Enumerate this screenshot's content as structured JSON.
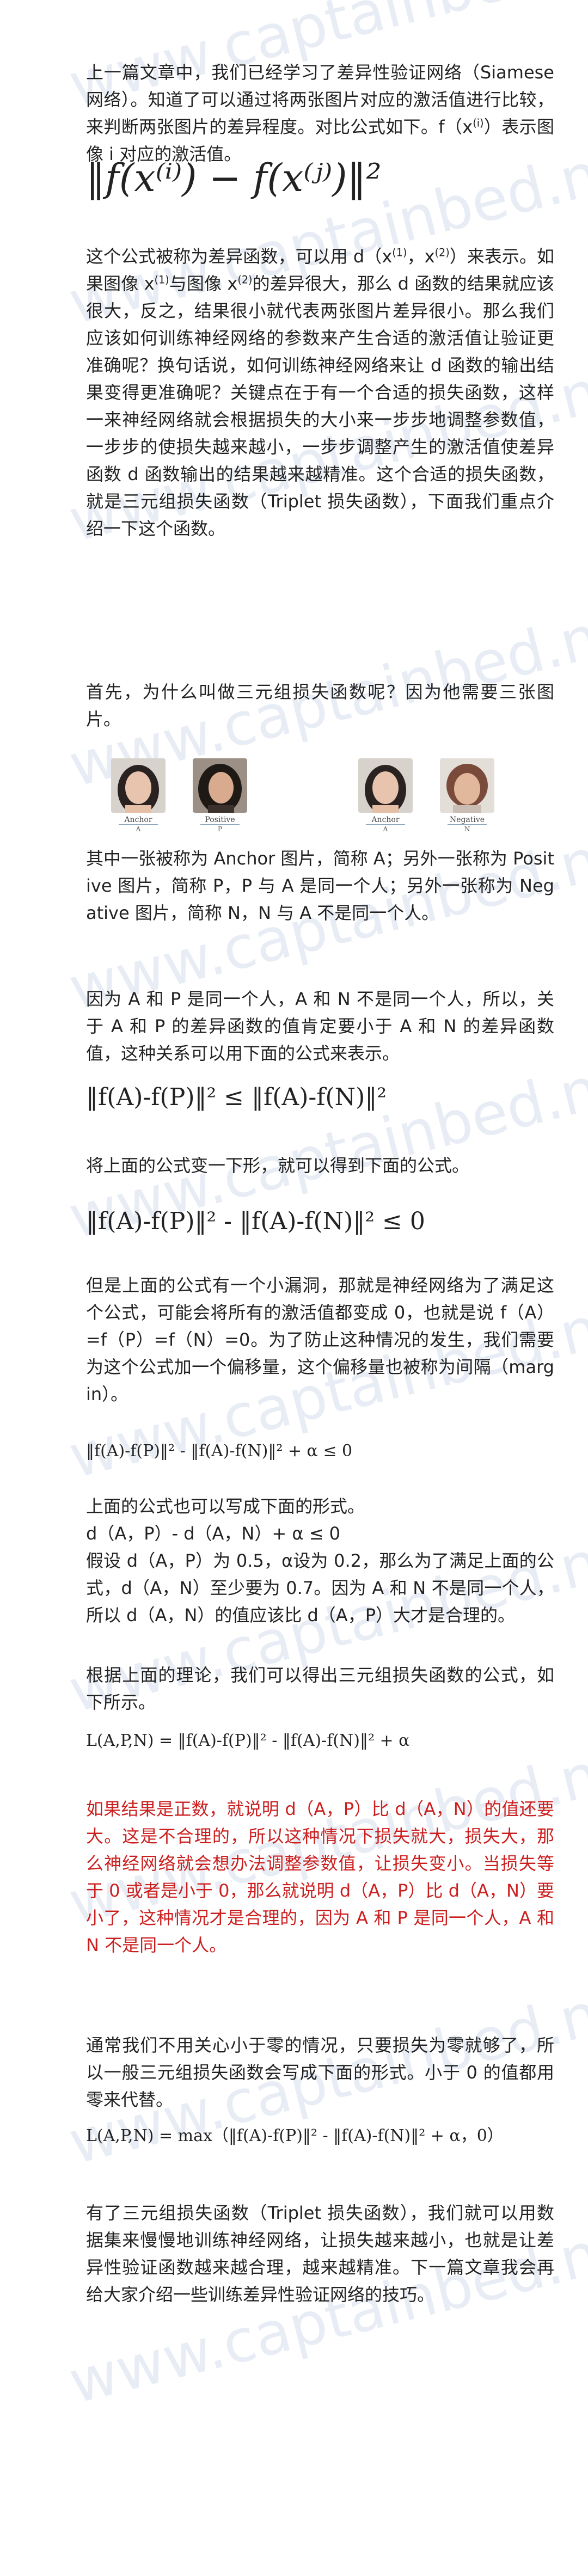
{
  "watermark": "www.captainbed.net",
  "colors": {
    "text": "#222222",
    "highlight_red": "#cc1f1f",
    "watermark": "#6e8cbe"
  },
  "intro": {
    "p1_a": "上一篇文章中，我们已经学习了差异性验证网络（Siamese 网络）。知道了可以通过将两张图片对应的激活值进行比较，来判断两张图片的差异程度。对比公式如下。f（x",
    "p1_sup1": "(i)",
    "p1_b": "）表示图像 i 对应的激活值。",
    "formula_norm": "‖f(x⁽ⁱ⁾) − f(x⁽ʲ⁾)‖²",
    "p2_a": "这个公式被称为差异函数，可以用 d（x",
    "p2_sup1": "(1)",
    "p2_b": "，x",
    "p2_sup2": "(2)",
    "p2_c": "）来表示。如果图像 x",
    "p2_sup3": "(1)",
    "p2_d": "与图像 x",
    "p2_sup4": "(2)",
    "p2_e": "的差异很大，那么 d 函数的结果就应该很大，反之，结果很小就代表两张图片差异很小。那么我们应该如何训练神经网络的参数来产生合适的激活值让验证更准确呢？换句话说，如何训练神经网络来让 d 函数的输出结果变得更准确呢？关键点在于有一个合适的损失函数，这样一来神经网络就会根据损失的大小来一步步地调整参数值，一步步的使损失越来越小，一步步调整产生的激活值使差异函数 d 函数输出的结果越来越精准。这个合适的损失函数，就是三元组损失函数（Triplet 损失函数），下面我们重点介绍一下这个函数。"
  },
  "why": {
    "p3": "首先，为什么叫做三元组损失函数呢？因为他需要三张图片。"
  },
  "photos": {
    "anchor1": {
      "label": "Anchor",
      "sub": "A"
    },
    "positive": {
      "label": "Positive",
      "sub": "P"
    },
    "anchor2": {
      "label": "Anchor",
      "sub": "A"
    },
    "negative": {
      "label": "Negative",
      "sub": "N"
    }
  },
  "explain": {
    "p4": "其中一张被称为 Anchor 图片，简称 A；另外一张称为 Positive 图片，简称 P，P 与 A 是同一个人；另外一张称为 Negative 图片，简称 N，N 与 A 不是同一个人。",
    "p5": "因为 A 和 P 是同一个人，A 和 N 不是同一个人，所以，关于 A 和 P 的差异函数的值肯定要小于 A 和 N 的差异函数值，这种关系可以用下面的公式来表示。",
    "formula1": "‖f(A)-f(P)‖² ≤ ‖f(A)-f(N)‖²",
    "p6": "将上面的公式变一下形，就可以得到下面的公式。",
    "formula2": "‖f(A)-f(P)‖² - ‖f(A)-f(N)‖² ≤ 0",
    "p7": "但是上面的公式有一个小漏洞，那就是神经网络为了满足这个公式，可能会将所有的激活值都变成 0，也就是说 f（A）=f（P）=f（N）=0。为了防止这种情况的发生，我们需要为这个公式加一个偏移量，这个偏移量也被称为间隔（margin）。",
    "formula3": "‖f(A)-f(P)‖² - ‖f(A)-f(N)‖² + α ≤ 0",
    "p8_line1": "上面的公式也可以写成下面的形式。",
    "p8_line2": "d（A，P）- d（A，N）+ α ≤ 0",
    "p8_rest": "假设 d（A，P）为 0.5，α设为 0.2，那么为了满足上面的公式，d（A，N）至少要为 0.7。因为 A 和 N 不是同一个人，所以 d（A，N）的值应该比 d（A，P）大才是合理的。",
    "p9": "根据上面的理论，我们可以得出三元组损失函数的公式，如下所示。",
    "formula4": "L(A,P,N) =   ‖f(A)-f(P)‖² - ‖f(A)-f(N)‖² + α",
    "p10_red": "如果结果是正数，就说明 d（A，P）比 d（A，N）的值还要大。这是不合理的，所以这种情况下损失就大，损失大，那么神经网络就会想办法调整参数值，让损失变小。当损失等于 0 或者是小于 0，那么就说明 d（A，P）比 d（A，N）要小了，这种情况才是合理的，因为 A 和 P 是同一个人，A 和 N 不是同一个人。",
    "p11": "通常我们不用关心小于零的情况，只要损失为零就够了，所以一般三元组损失函数会写成下面的形式。小于 0 的值都用零来代替。",
    "formula5": "L(A,P,N) = max（‖f(A)-f(P)‖² - ‖f(A)-f(N)‖² + α，0）",
    "p12": "有了三元组损失函数（Triplet 损失函数），我们就可以用数据集来慢慢地训练神经网络，让损失越来越小，也就是让差异性验证函数越来越合理，越来越精准。下一篇文章我会再给大家介绍一些训练差异性验证网络的技巧。"
  }
}
